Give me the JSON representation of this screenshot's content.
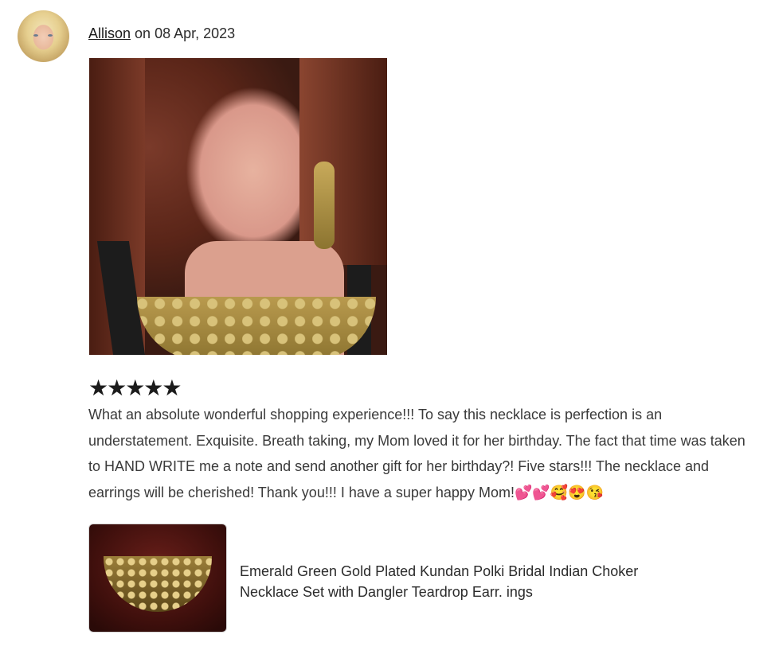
{
  "review": {
    "author": "Allison",
    "date_text": "on 08 Apr, 2023",
    "stars": "★★★★★",
    "rating": 5,
    "text": "What an absolute wonderful shopping experience!!! To say this necklace is perfection is an understatement. Exquisite. Breath taking, my Mom loved it for her birthday. The fact that time was taken to HAND WRITE me a note and send another gift for her birthday?! Five stars!!! The necklace and earrings will be cherished! Thank you!!! I have a super happy Mom!💕💕🥰😍😘"
  },
  "product": {
    "title": "Emerald Green Gold Plated Kundan Polki Bridal Indian Choker Necklace Set with Dangler Teardrop Earr. ings"
  }
}
